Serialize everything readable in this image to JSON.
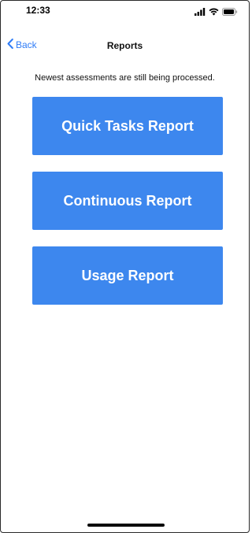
{
  "status_bar": {
    "time": "12:33",
    "icons": [
      "cellular-signal-icon",
      "wifi-icon",
      "battery-icon"
    ]
  },
  "nav": {
    "back_label": "Back",
    "title": "Reports"
  },
  "notice": "Newest assessments are still being processed.",
  "buttons": {
    "quick_tasks": "Quick Tasks Report",
    "continuous": "Continuous Report",
    "usage": "Usage Report"
  },
  "colors": {
    "accent": "#2f7cf6",
    "button_bg": "#3d87ee",
    "button_text": "#ffffff"
  }
}
